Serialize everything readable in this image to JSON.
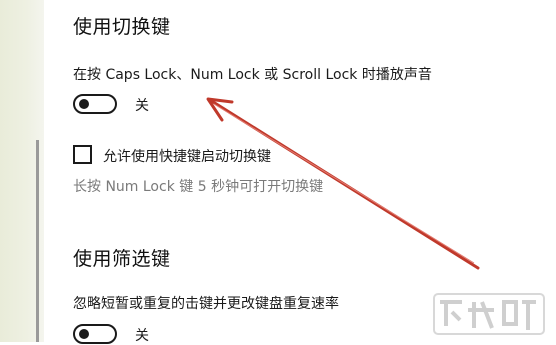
{
  "toggle_keys": {
    "heading": "使用切换键",
    "description": "在按 Caps Lock、Num Lock 或 Scroll Lock 时播放声音",
    "toggle_state_label": "关",
    "shortcut_checkbox_label": "允许使用快捷键启动切换键",
    "hint": "长按 Num Lock 键 5 秒钟可打开切换键"
  },
  "filter_keys": {
    "heading": "使用筛选键",
    "description": "忽略短暂或重复的击键并更改键盘重复速率",
    "toggle_state_label": "关"
  },
  "watermark": {
    "text": "下载吧"
  },
  "colors": {
    "annotation_arrow": "#c0392b"
  }
}
